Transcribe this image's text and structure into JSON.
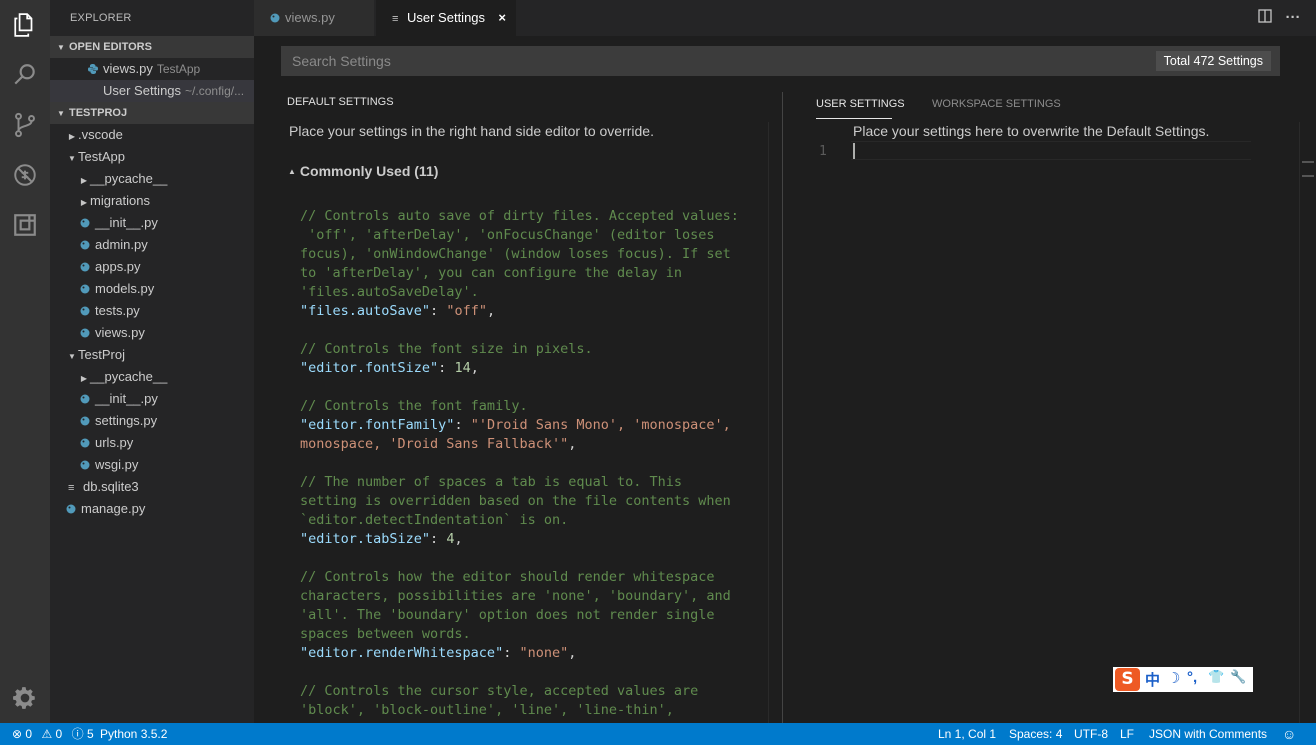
{
  "activity_bar": {
    "icons": [
      "files-icon",
      "search-icon",
      "source-control-icon",
      "debug-icon",
      "extensions-icon",
      "settings-gear-icon"
    ]
  },
  "sidebar": {
    "title": "EXPLORER",
    "open_editors_label": "OPEN EDITORS",
    "open_editors": [
      {
        "name": "views.py",
        "desc": "TestApp"
      },
      {
        "name": "User Settings",
        "desc": "~/.config/..."
      }
    ],
    "project_label": "TESTPROJ",
    "tree": [
      {
        "label": ".vscode"
      },
      {
        "label": "TestApp"
      },
      {
        "label": "__pycache__"
      },
      {
        "label": "migrations"
      },
      {
        "label": "__init__.py"
      },
      {
        "label": "admin.py"
      },
      {
        "label": "apps.py"
      },
      {
        "label": "models.py"
      },
      {
        "label": "tests.py"
      },
      {
        "label": "views.py"
      },
      {
        "label": "TestProj"
      },
      {
        "label": "__pycache__"
      },
      {
        "label": "__init__.py"
      },
      {
        "label": "settings.py"
      },
      {
        "label": "urls.py"
      },
      {
        "label": "wsgi.py"
      },
      {
        "label": "db.sqlite3"
      },
      {
        "label": "manage.py"
      }
    ]
  },
  "tabs": [
    {
      "label": "views.py"
    },
    {
      "label": "User Settings",
      "close": "×"
    }
  ],
  "search": {
    "placeholder": "Search Settings",
    "total": "Total 472 Settings"
  },
  "default_settings": {
    "header": "DEFAULT SETTINGS",
    "intro": "Place your settings in the right hand side editor to override.",
    "group": "Commonly Used (11)",
    "code": [
      {
        "t": "comment",
        "text": "// Controls auto save of dirty files. Accepted values:"
      },
      {
        "t": "comment",
        "text": " 'off', 'afterDelay', 'onFocusChange' (editor loses"
      },
      {
        "t": "comment",
        "text": "focus), 'onWindowChange' (window loses focus). If set"
      },
      {
        "t": "comment",
        "text": "to 'afterDelay', you can configure the delay in"
      },
      {
        "t": "comment",
        "text": "'files.autoSaveDelay'."
      },
      {
        "t": "kv",
        "key": "\"files.autoSave\"",
        "value": "\"off\"",
        "vt": "str"
      },
      {
        "t": "blank",
        "text": ""
      },
      {
        "t": "comment",
        "text": "// Controls the font size in pixels."
      },
      {
        "t": "kv",
        "key": "\"editor.fontSize\"",
        "value": "14",
        "vt": "num"
      },
      {
        "t": "blank",
        "text": ""
      },
      {
        "t": "comment",
        "text": "// Controls the font family."
      },
      {
        "t": "kv",
        "key": "\"editor.fontFamily\"",
        "value": "\"'Droid Sans Mono', 'monospace',",
        "vt": "str",
        "nocomma": true
      },
      {
        "t": "cont",
        "value": "monospace, 'Droid Sans Fallback'\"",
        "vt": "str"
      },
      {
        "t": "blank",
        "text": ""
      },
      {
        "t": "comment",
        "text": "// The number of spaces a tab is equal to. This"
      },
      {
        "t": "comment",
        "text": "setting is overridden based on the file contents when"
      },
      {
        "t": "comment",
        "text": "`editor.detectIndentation` is on."
      },
      {
        "t": "kv",
        "key": "\"editor.tabSize\"",
        "value": "4",
        "vt": "num"
      },
      {
        "t": "blank",
        "text": ""
      },
      {
        "t": "comment",
        "text": "// Controls how the editor should render whitespace"
      },
      {
        "t": "comment",
        "text": "characters, possibilities are 'none', 'boundary', and"
      },
      {
        "t": "comment",
        "text": "'all'. The 'boundary' option does not render single"
      },
      {
        "t": "comment",
        "text": "spaces between words."
      },
      {
        "t": "kv",
        "key": "\"editor.renderWhitespace\"",
        "value": "\"none\"",
        "vt": "str"
      },
      {
        "t": "blank",
        "text": ""
      },
      {
        "t": "comment",
        "text": "// Controls the cursor style, accepted values are"
      },
      {
        "t": "comment",
        "text": "'block', 'block-outline', 'line', 'line-thin',"
      }
    ]
  },
  "user_settings": {
    "tab_user": "USER SETTINGS",
    "tab_workspace": "WORKSPACE SETTINGS",
    "intro": "Place your settings here to overwrite the Default Settings.",
    "line_number": "1"
  },
  "ime": {
    "logo": "S",
    "items": [
      "中",
      "☽",
      "°,",
      "👕",
      "🔧"
    ]
  },
  "status_bar": {
    "errors": "0",
    "warnings": "0",
    "info": "5",
    "python": "Python 3.5.2",
    "position": "Ln 1, Col 1",
    "spaces": "Spaces: 4",
    "encoding": "UTF-8",
    "eol": "LF",
    "language": "JSON with Comments"
  },
  "colors": {
    "status_bar": "#007acc",
    "activity_bar": "#333333",
    "sidebar": "#252526",
    "editor": "#1e1e1e",
    "comment": "#608b4e",
    "key": "#9cdcfe",
    "string": "#ce9178",
    "number": "#b5cea8"
  }
}
